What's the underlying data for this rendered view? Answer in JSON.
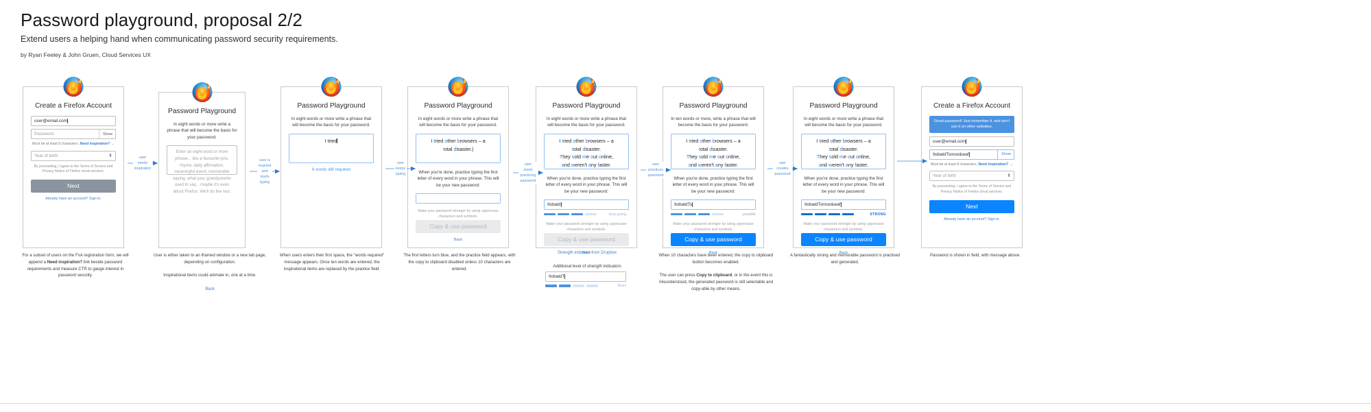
{
  "header": {
    "title": "Password playground, proposal 2/2",
    "subtitle": "Extend users a helping hand when communicating password security requirements.",
    "byline": "by Ryan Feeley & John Gruen, Cloud Services UX"
  },
  "colors": {
    "accent_blue": "#4b92e0",
    "primary_button": "#0a84ff",
    "disabled_button": "#e8eaec",
    "gray_button": "#8a949e",
    "strength_empty": "#d7e4f3",
    "strength_full": "#0a6ed1"
  },
  "common": {
    "firefox_logo": "firefox-logo-icon",
    "playground_title": "Password Playground",
    "prompt_eight": "In eight words or more write a phrase that will become the basis for your password.",
    "prompt_ten": "In ten words or more, write a phrase that will become the basis for your password.",
    "practice_text": "When you're done, practice typing the first letter of every word in your phrase. This will be your new password:",
    "tip_text": "Make your password stronger by using uppercase characters and symbols.",
    "copy_use_label": "Copy & use password",
    "back_label": "Back"
  },
  "panels": [
    {
      "id": "panel-1",
      "kind": "fxa-signup",
      "title": "Create a Firefox Account",
      "email_value": "user@email.com",
      "password_placeholder": "Password",
      "show_label": "Show",
      "hint_text": "Must be at least 8 characters.",
      "hint_link": "Need inspiration?",
      "birth_placeholder": "Year of birth",
      "legal": "By proceeding, I agree to the Terms of Service and Privacy Notice of Firefox cloud services.",
      "next_label": "Next",
      "signin_label": "Already have an account? Sign in.",
      "caption": "For a subset of users on the FxA registration form, we will append a <b>Need inspiration?</b> link beside password requirements and measure CTR to gauge interest in password security."
    },
    {
      "id": "panel-2",
      "kind": "playground-empty",
      "title": "Password Playground",
      "prompt": "In eight words or more write a phrase that will become the basis for your password.",
      "textarea_placeholder": "Enter an eight-word or more phrase... like a favourite lyric, rhyme, daily affirmation, meaningful event, memorable saying, what your grandparents used to say... maybe it's even about Firefox. We'll do the rest.",
      "back_label": "Back",
      "caption": "User is either taken to an iframed window or a new tab page, depending on configuration.",
      "caption2": "Inspirational items could animate in, one at a time.",
      "caption_back": "Back"
    },
    {
      "id": "panel-3",
      "kind": "playground-typing",
      "title": "Password Playground",
      "prompt": "In eight words or more write a phrase that will become the basis for your password.",
      "textarea_value": "I tried",
      "words_note": "6 words still required",
      "caption": "When users enters their first space, the \"words required\" message appears. Once ten words are entered, the inspirational items are replaced by the practice field."
    },
    {
      "id": "panel-4",
      "kind": "playground-practice",
      "title": "Password Playground",
      "prompt": "In eight words or more write a phrase that will become the basis for your password.",
      "phrase_lines": [
        [
          [
            "I ",
            "plain"
          ],
          [
            "t",
            "hl"
          ],
          [
            "ried ",
            "plain"
          ],
          [
            "o",
            "hl"
          ],
          [
            "ther ",
            "plain"
          ],
          [
            "b",
            "hl"
          ],
          [
            "rowsers – a",
            "plain"
          ]
        ],
        [
          [
            "t",
            "hl"
          ],
          [
            "otal ",
            "plain"
          ],
          [
            "d",
            "hl"
          ],
          [
            "isaster.",
            "plain"
          ],
          [
            "|",
            "caret"
          ]
        ]
      ],
      "practice_text": "When you're done, practice typing the first letter of every word in your phrase. This will be your new password:",
      "password_value": "",
      "tip_text": "Make your password stronger by using uppercase characters and symbols.",
      "copy_label": "Copy & use password",
      "back_label": "Back",
      "caption": "The first letters turn blue, and the practice field appears, with the copy to clipboard disabled unless 10 characters are entered."
    },
    {
      "id": "panel-5",
      "kind": "playground-password",
      "title": "Password Playground",
      "prompt": "In eight words or more write a phrase that will become the basis for your password.",
      "phrase_lines": [
        [
          [
            "I ",
            "plain"
          ],
          [
            "t",
            "hl"
          ],
          [
            "ried ",
            "plain"
          ],
          [
            "o",
            "hl"
          ],
          [
            "ther ",
            "plain"
          ],
          [
            "b",
            "hl"
          ],
          [
            "rowsers – a",
            "plain"
          ]
        ],
        [
          [
            "t",
            "hl"
          ],
          [
            "otal ",
            "plain"
          ],
          [
            "d",
            "hl"
          ],
          [
            "isaster.",
            "plain"
          ]
        ],
        [
          [
            "T",
            "hl"
          ],
          [
            "hey ",
            "plain"
          ],
          [
            "s",
            "hl"
          ],
          [
            "old ",
            "plain"
          ],
          [
            "m",
            "hl"
          ],
          [
            "e ",
            "plain"
          ],
          [
            "o",
            "hl"
          ],
          [
            "ut ",
            "plain"
          ],
          [
            "o",
            "hl"
          ],
          [
            "nline,",
            "plain"
          ]
        ],
        [
          [
            "a",
            "hl"
          ],
          [
            "nd ",
            "plain"
          ],
          [
            "w",
            "hl"
          ],
          [
            "eren't ",
            "plain"
          ],
          [
            "a",
            "hl"
          ],
          [
            "ny ",
            "plain"
          ],
          [
            "f",
            "hl"
          ],
          [
            "aster.",
            "plain"
          ]
        ]
      ],
      "practice_text": "When you're done, practice typing the first letter of every word in your phrase. This will be your new password:",
      "password_value": "Itobatd",
      "strength_segments": [
        1,
        1,
        1,
        0
      ],
      "strength_label": "keep going...",
      "tip_text": "Make your password stronger by using uppercase characters and symbols.",
      "copy_label": "Copy & use password",
      "back_label": "Back",
      "caption": "Strength indicator from Dropbox",
      "caption2": "Additional level of strength indicators",
      "extra_field_value": "ItobatdT",
      "extra_strength_segments": [
        1,
        1,
        0,
        0
      ],
      "extra_strength_label": "Basic"
    },
    {
      "id": "panel-6",
      "kind": "playground-password-2",
      "title": "Password Playground",
      "prompt": "In ten words or more, write a phrase that will become the basis for your password.",
      "phrase_lines": [
        [
          [
            "I ",
            "plain"
          ],
          [
            "t",
            "hl"
          ],
          [
            "ried ",
            "plain"
          ],
          [
            "o",
            "hl"
          ],
          [
            "ther ",
            "plain"
          ],
          [
            "b",
            "hl"
          ],
          [
            "rowsers – a",
            "plain"
          ]
        ],
        [
          [
            "t",
            "hl"
          ],
          [
            "otal ",
            "plain"
          ],
          [
            "d",
            "hl"
          ],
          [
            "isaster.",
            "plain"
          ]
        ],
        [
          [
            "T",
            "hl"
          ],
          [
            "hey ",
            "plain"
          ],
          [
            "s",
            "hl"
          ],
          [
            "old ",
            "plain"
          ],
          [
            "m",
            "hl"
          ],
          [
            "e ",
            "plain"
          ],
          [
            "o",
            "hl"
          ],
          [
            "ut ",
            "plain"
          ],
          [
            "o",
            "hl"
          ],
          [
            "nline,",
            "plain"
          ]
        ],
        [
          [
            "a",
            "hl"
          ],
          [
            "nd ",
            "plain"
          ],
          [
            "w",
            "hl"
          ],
          [
            "eren't ",
            "plain"
          ],
          [
            "a",
            "hl"
          ],
          [
            "ny ",
            "plain"
          ],
          [
            "f",
            "hl"
          ],
          [
            "aster.",
            "plain"
          ]
        ]
      ],
      "practice_text": "When you're done, practice typing the first letter of every word in your phrase. This will be your new password:",
      "password_value": "ItobatdTs",
      "strength_segments": [
        1,
        1,
        1,
        0
      ],
      "strength_label": "possible",
      "tip_text": "Make your password stronger by using uppercase characters and symbols.",
      "copy_label": "Copy & use password",
      "back_label": "Back",
      "caption": "When 10 characters have been entered, the copy to clipboard button becomes enabled.",
      "caption2": "The user can press <b>Copy to clipboard</b>, or in the event this is misunderstood, the generated password is still selectable and copy-able by other means."
    },
    {
      "id": "panel-7",
      "kind": "playground-strong",
      "title": "Password Playground",
      "prompt": "In eight words or more write a phrase that will become the basis for your password.",
      "phrase_lines": [
        [
          [
            "I ",
            "plain"
          ],
          [
            "t",
            "hl"
          ],
          [
            "ried ",
            "plain"
          ],
          [
            "o",
            "hl"
          ],
          [
            "ther ",
            "plain"
          ],
          [
            "b",
            "hl"
          ],
          [
            "rowsers – a",
            "plain"
          ]
        ],
        [
          [
            "t",
            "hl"
          ],
          [
            "otal ",
            "plain"
          ],
          [
            "d",
            "hl"
          ],
          [
            "isaster.",
            "plain"
          ]
        ],
        [
          [
            "T",
            "hl"
          ],
          [
            "hey ",
            "plain"
          ],
          [
            "s",
            "hl"
          ],
          [
            "old ",
            "plain"
          ],
          [
            "m",
            "hl"
          ],
          [
            "e ",
            "plain"
          ],
          [
            "o",
            "hl"
          ],
          [
            "ut ",
            "plain"
          ],
          [
            "o",
            "hl"
          ],
          [
            "nline,",
            "plain"
          ]
        ],
        [
          [
            "a",
            "hl"
          ],
          [
            "nd ",
            "plain"
          ],
          [
            "w",
            "hl"
          ],
          [
            "eren't ",
            "plain"
          ],
          [
            "a",
            "hl"
          ],
          [
            "ny ",
            "plain"
          ],
          [
            "f",
            "hl"
          ],
          [
            "aster.",
            "plain"
          ]
        ]
      ],
      "practice_text": "When you're done, practice typing the first letter of every word in your phrase. This will be your new password:",
      "password_value": "ItobatdTsmoo&waf",
      "strength_segments": [
        1,
        1,
        1,
        1
      ],
      "strength_label": "STRONG",
      "tip_text": "Make your password stronger by using uppercase characters and symbols.",
      "copy_label": "Copy & use password",
      "back_label": "Back",
      "caption": "A fantastically strong and memorable password is practised and generated."
    },
    {
      "id": "panel-8",
      "kind": "fxa-filled",
      "title": "Create a Firefox Account",
      "banner": "Great password! Just remember it, and don't use it on other websites.",
      "email_value": "user@email.com",
      "password_value": "ItobatdTsmoo&waf",
      "show_label": "Show",
      "hint_text": "Must be at least 8 characters.",
      "hint_link": "Need inspiration?",
      "birth_placeholder": "Year of birth",
      "legal": "By proceeding, I agree to the Terms of Service and Privacy Notice of Firefox cloud services.",
      "next_label": "Next",
      "signin_label": "Already have an account? Sign in.",
      "caption": "Password is shown in field, with message above."
    }
  ],
  "connectors": [
    {
      "id": "conn-1",
      "label": "user\nneeds\ninspiration"
    },
    {
      "id": "conn-2",
      "label": "user is\ninspired\nand\nstarts\ntyping"
    },
    {
      "id": "conn-3",
      "label": "user\nkeeps\ntyping"
    },
    {
      "id": "conn-4",
      "label": "user\nstarts\npracticing\npassword"
    },
    {
      "id": "conn-5",
      "label": "user\npractices\npassword"
    },
    {
      "id": "conn-6",
      "label": "user\ncreates\npassword"
    },
    {
      "id": "conn-7",
      "label": ""
    }
  ]
}
